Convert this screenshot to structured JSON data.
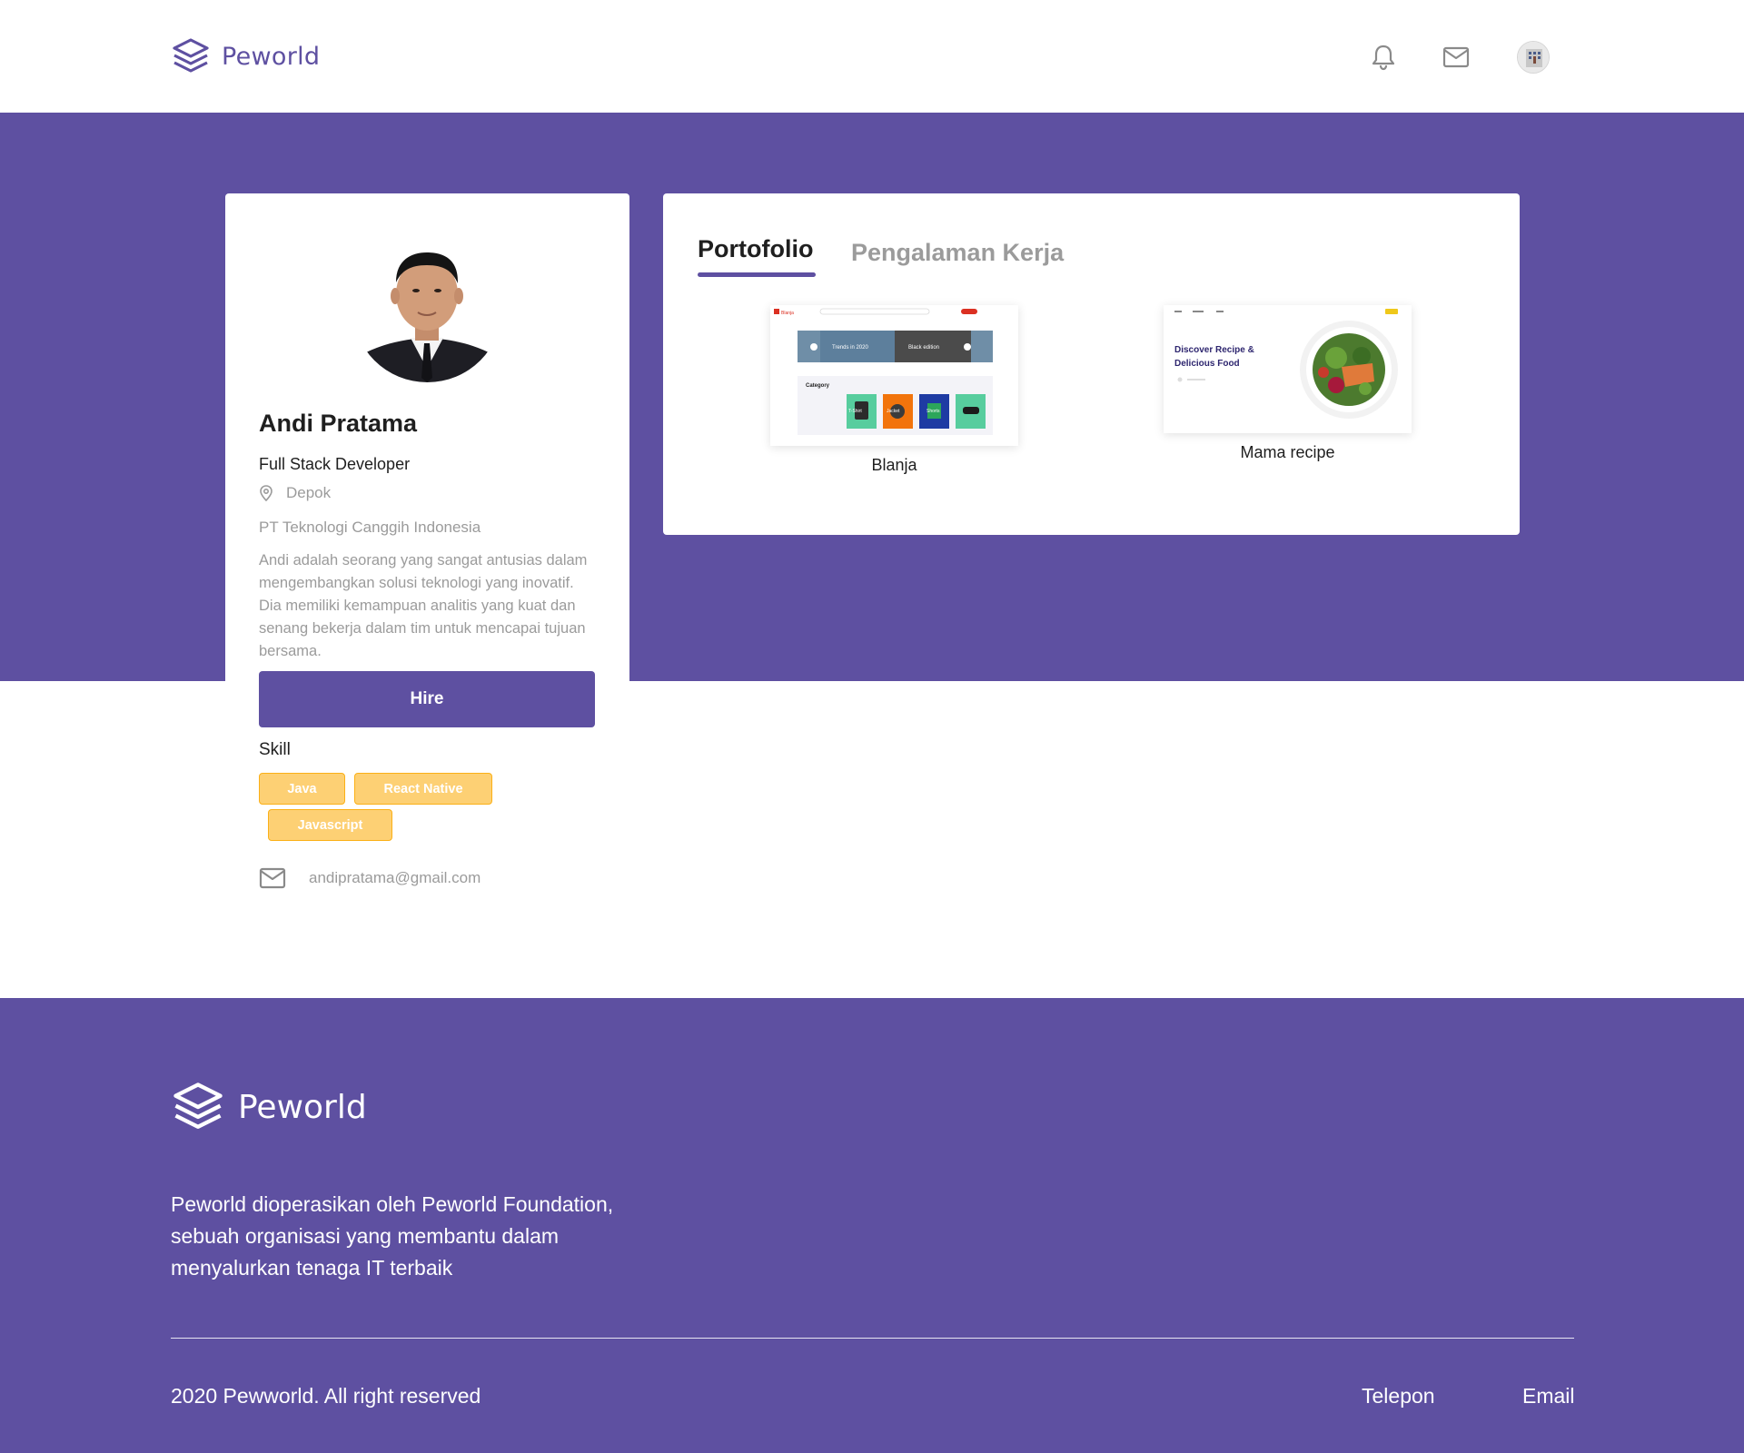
{
  "brand": {
    "name": "Peworld",
    "color": "#5e50a1"
  },
  "header": {
    "icons": [
      "bell-icon",
      "mail-icon"
    ],
    "avatar": "user-avatar"
  },
  "profile": {
    "name": "Andi Pratama",
    "job": "Full Stack Developer",
    "location": "Depok",
    "company": "PT Teknologi Canggih Indonesia",
    "bio": "Andi adalah seorang yang sangat antusias dalam mengembangkan solusi teknologi yang inovatif. Dia memiliki kemampuan analitis yang kuat dan senang bekerja dalam tim untuk mencapai tujuan bersama.",
    "hire_label": "Hire",
    "skill_title": "Skill",
    "skills": [
      "Java",
      "React Native",
      "Javascript"
    ],
    "email": "andipratama@gmail.com",
    "skill_color": "#fbb017"
  },
  "tabs": {
    "active": "Portofolio",
    "inactive": "Pengalaman Kerja"
  },
  "portfolio": [
    {
      "title": "Blanja",
      "thumb": {
        "brand": "Blanja",
        "banners": [
          "Trends in 2020",
          "Black edition"
        ],
        "category_label": "Category",
        "categories": [
          "T-Shirt",
          "Jacket",
          "Shorts"
        ]
      }
    },
    {
      "title": "Mama recipe",
      "thumb": {
        "headline_1": "Discover Recipe &",
        "headline_2": "Delicious Food"
      }
    }
  ],
  "footer": {
    "brand": "Peworld",
    "description": "Peworld dioperasikan oleh Peworld Foundation, sebuah organisasi yang membantu dalam menyalurkan tenaga IT terbaik",
    "copyright": "2020 Pewworld. All right reserved",
    "link_phone": "Telepon",
    "link_email": "Email"
  }
}
